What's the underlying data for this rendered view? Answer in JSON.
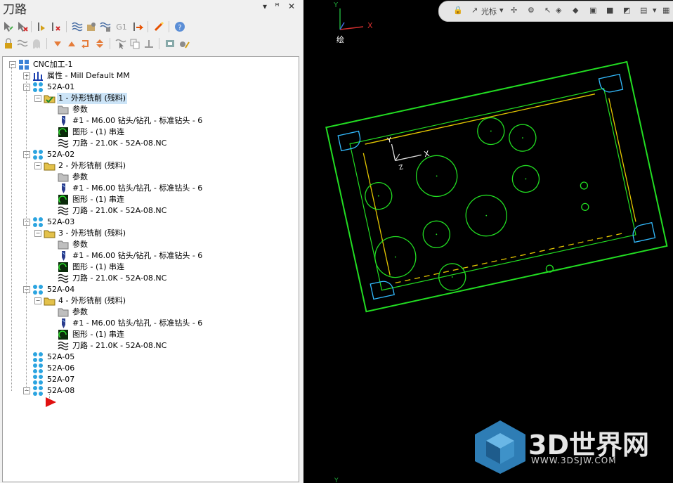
{
  "panel": {
    "title": "刀路",
    "dropdown": "▾",
    "pin": "ꟸ",
    "close": "✕"
  },
  "viewport": {
    "toolbar": {
      "cursor_label": "光标"
    },
    "view_label": "绘",
    "axis_x": "X",
    "axis_y": "Y",
    "wcs_x": "X",
    "wcs_y": "Y",
    "wcs_z": "Z"
  },
  "watermark": {
    "main": "3D世界网",
    "sub": "WWW.3DSJW.COM"
  },
  "tree": {
    "root": "CNC加工-1",
    "props": "属性 - Mill Default MM",
    "groups": [
      {
        "name": "52A-01",
        "op": "1 - 外形铣削 (残料)",
        "params": "参数",
        "tool": "#1 - M6.00 钻头/钻孔 - 标准钻头 - 6",
        "geom": "图形 - (1) 串连",
        "path": "刀路 - 21.0K - 52A-08.NC"
      },
      {
        "name": "52A-02",
        "op": "2 - 外形铣削 (残料)",
        "params": "参数",
        "tool": "#1 - M6.00 钻头/钻孔 - 标准钻头 - 6",
        "geom": "图形 - (1) 串连",
        "path": "刀路 - 21.0K - 52A-08.NC"
      },
      {
        "name": "52A-03",
        "op": "3 - 外形铣削 (残料)",
        "params": "参数",
        "tool": "#1 - M6.00 钻头/钻孔 - 标准钻头 - 6",
        "geom": "图形 - (1) 串连",
        "path": "刀路 - 21.0K - 52A-08.NC"
      },
      {
        "name": "52A-04",
        "op": "4 - 外形铣削 (残料)",
        "params": "参数",
        "tool": "#1 - M6.00 钻头/钻孔 - 标准钻头 - 6",
        "geom": "图形 - (1) 串连",
        "path": "刀路 - 21.0K - 52A-08.NC"
      }
    ],
    "empty_groups": [
      "52A-05",
      "52A-06",
      "52A-07",
      "52A-08"
    ]
  }
}
